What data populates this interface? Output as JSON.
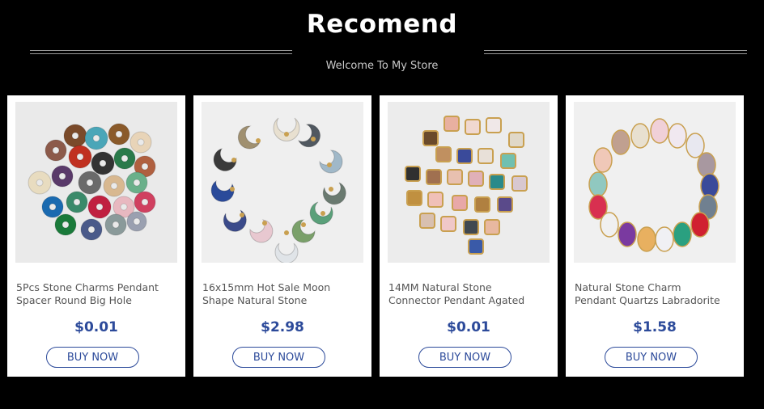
{
  "header": {
    "title": "Recomend",
    "subtitle": "Welcome To My Store"
  },
  "products": [
    {
      "title_line1": "5Pcs Stone Charms Pendant",
      "title_line2": "Spacer Round Big Hole",
      "price": "$0.01",
      "button": "BUY NOW",
      "image_type": "donut-beads"
    },
    {
      "title_line1": "16x15mm Hot Sale Moon",
      "title_line2": "Shape Natural Stone",
      "price": "$2.98",
      "button": "BUY NOW",
      "image_type": "moon-pendants"
    },
    {
      "title_line1": "14MM Natural Stone",
      "title_line2": "Connector Pendant Agated",
      "price": "$0.01",
      "button": "BUY NOW",
      "image_type": "square-connectors"
    },
    {
      "title_line1": "Natural Stone Charm",
      "title_line2": "Pendant Quartzs Labradorite",
      "price": "$1.58",
      "button": "BUY NOW",
      "image_type": "teardrop-pendants"
    }
  ],
  "colors": {
    "background": "#000000",
    "card": "#ffffff",
    "accent": "#2c4a9a"
  }
}
